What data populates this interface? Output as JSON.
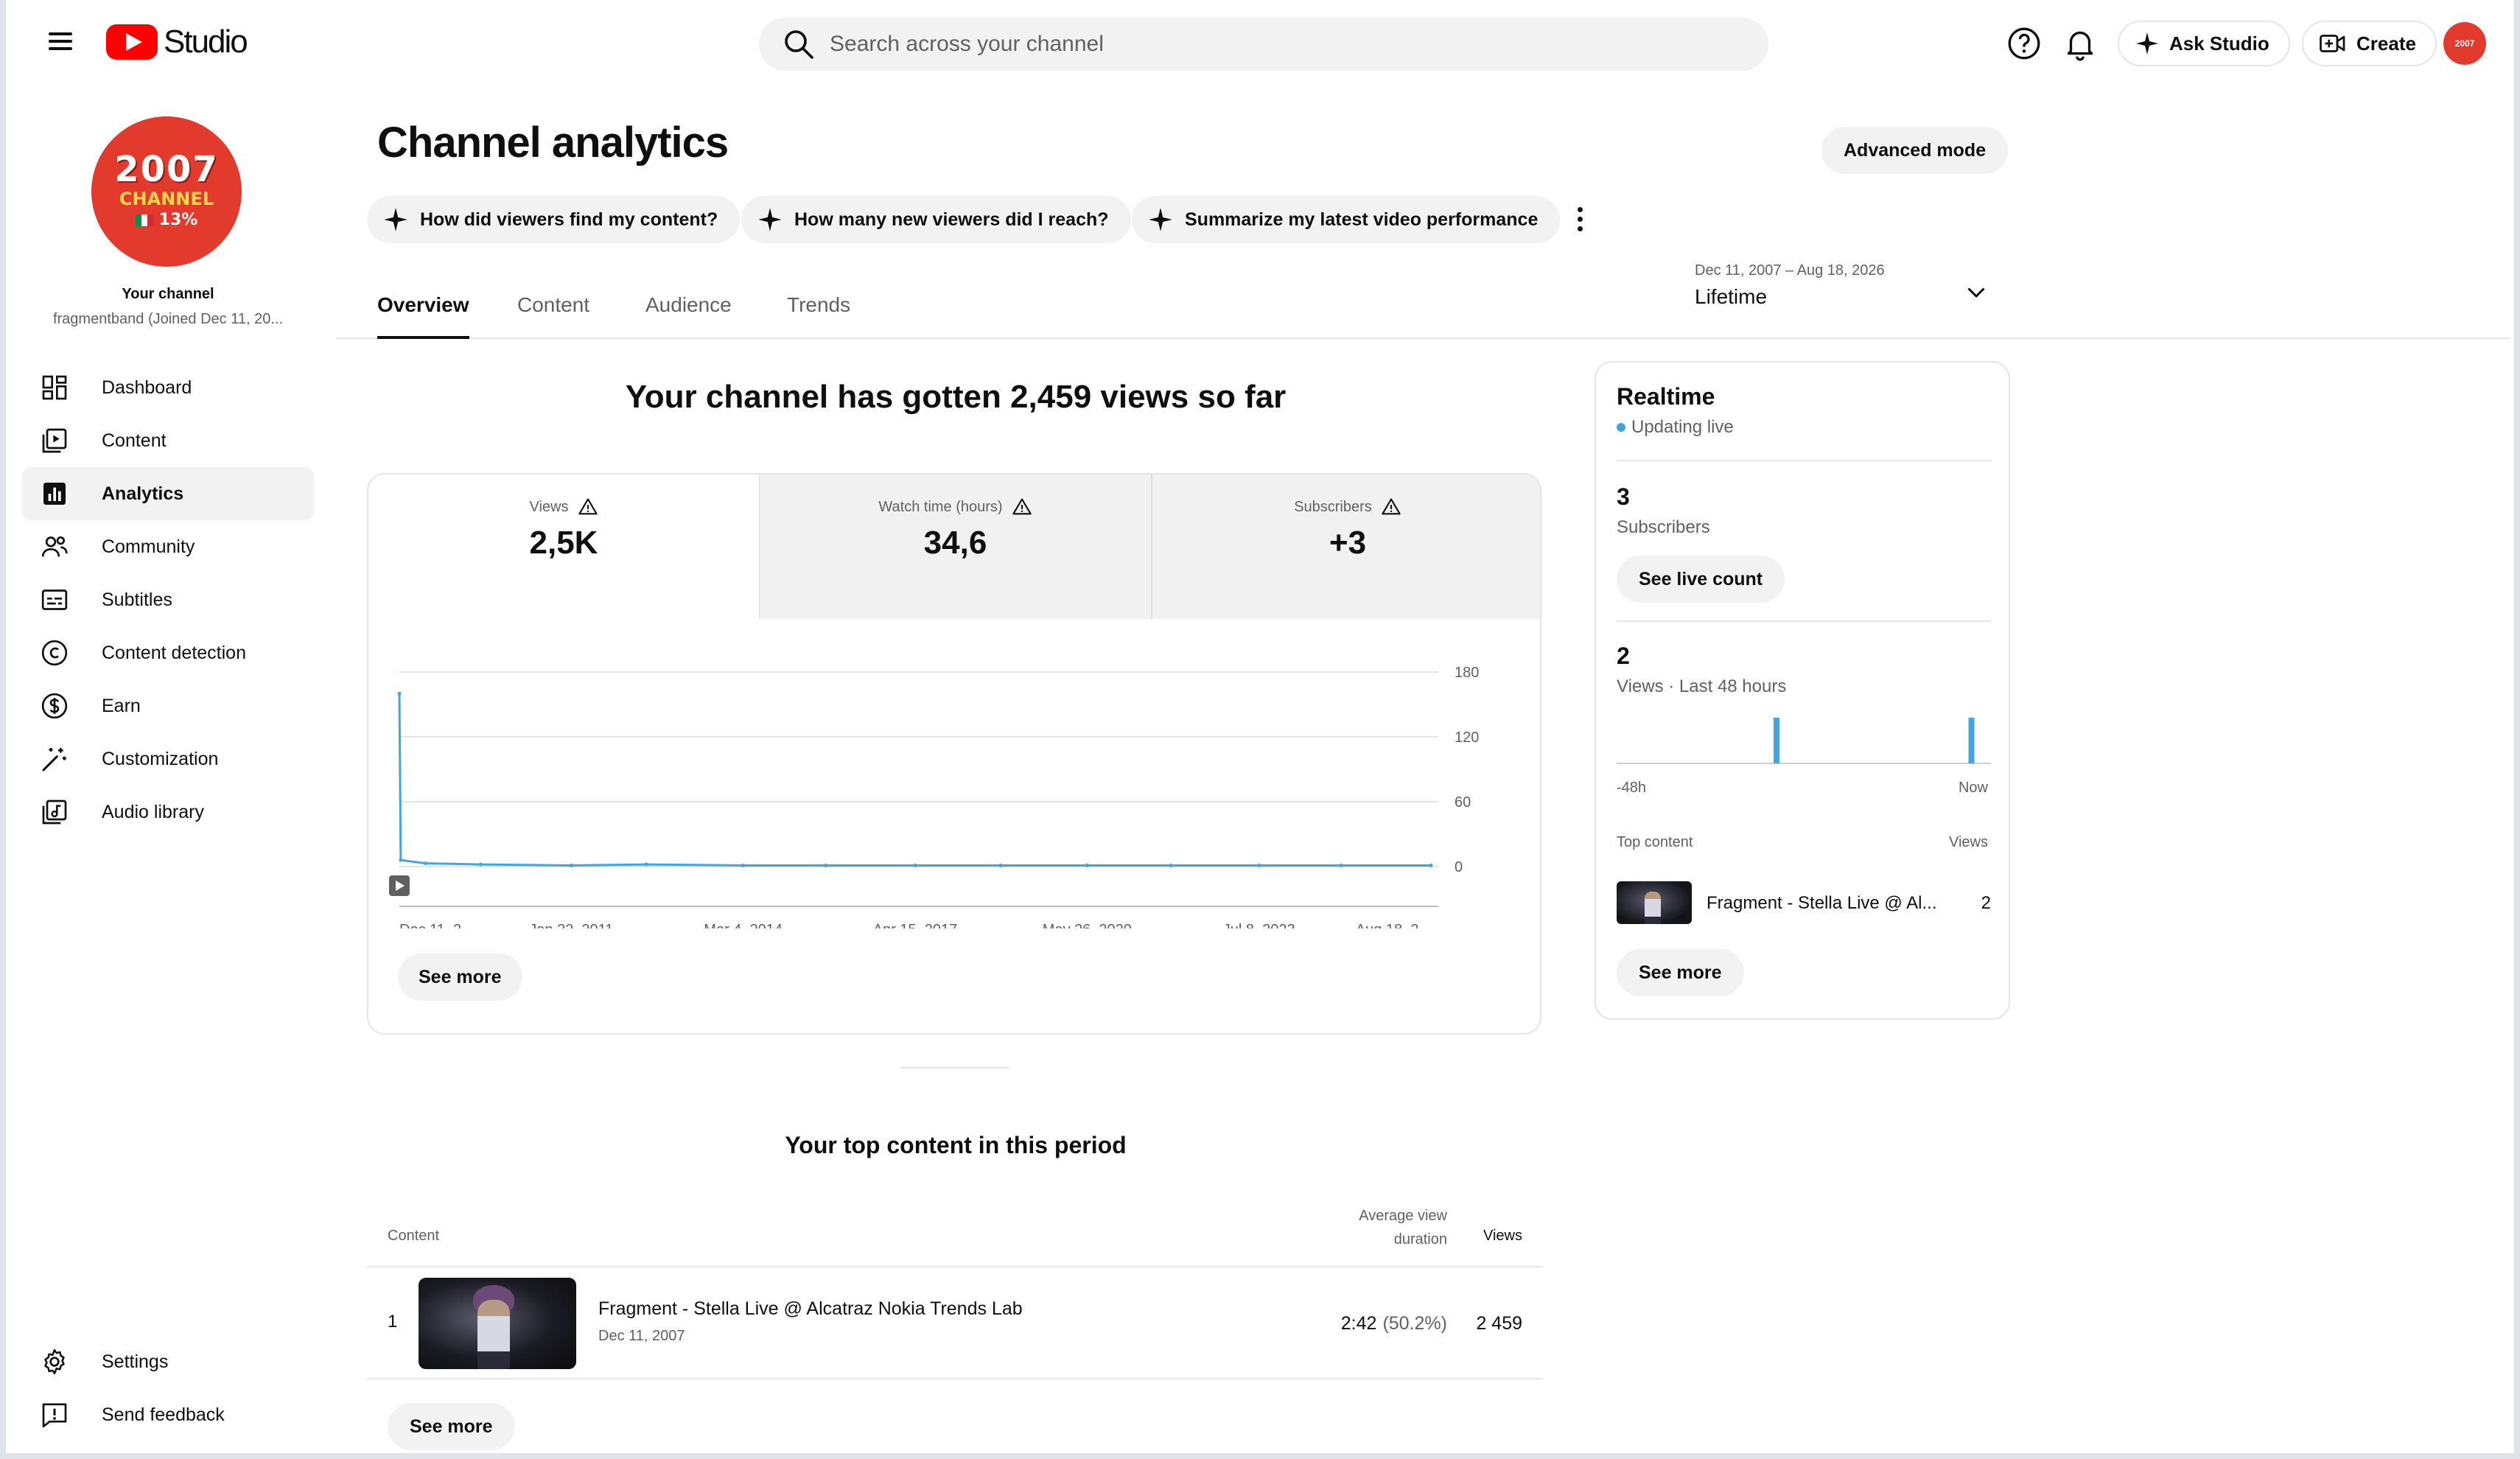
{
  "header": {
    "logo_text": "Studio",
    "search_placeholder": "Search across your channel",
    "ask_studio_label": "Ask Studio",
    "create_label": "Create",
    "avatar_text": "2007"
  },
  "sidebar": {
    "channel_avatar": {
      "year": "2007",
      "word": "CHANNEL",
      "pct": "13%"
    },
    "your_channel_label": "Your channel",
    "channel_handle": "fragmentband (Joined Dec 11, 20...",
    "items": [
      {
        "label": "Dashboard",
        "icon": "dashboard-icon"
      },
      {
        "label": "Content",
        "icon": "content-icon"
      },
      {
        "label": "Analytics",
        "icon": "analytics-icon",
        "active": true
      },
      {
        "label": "Community",
        "icon": "community-icon"
      },
      {
        "label": "Subtitles",
        "icon": "subtitles-icon"
      },
      {
        "label": "Content detection",
        "icon": "copyright-icon"
      },
      {
        "label": "Earn",
        "icon": "dollar-icon"
      },
      {
        "label": "Customization",
        "icon": "magic-wand-icon"
      },
      {
        "label": "Audio library",
        "icon": "audio-library-icon"
      }
    ],
    "bottom_items": [
      {
        "label": "Settings",
        "icon": "gear-icon"
      },
      {
        "label": "Send feedback",
        "icon": "feedback-icon"
      }
    ]
  },
  "main": {
    "title": "Channel analytics",
    "advanced_mode_label": "Advanced mode",
    "chips": [
      "How did viewers find my content?",
      "How many new viewers did I reach?",
      "Summarize my latest video performance"
    ],
    "tabs": [
      "Overview",
      "Content",
      "Audience",
      "Trends"
    ],
    "active_tab": "Overview",
    "date_range": {
      "range": "Dec 11, 2007 – Aug 18, 2026",
      "label": "Lifetime"
    },
    "headline": "Your channel has gotten 2,459 views so far",
    "metrics": [
      {
        "label": "Views",
        "value": "2,5K"
      },
      {
        "label": "Watch time (hours)",
        "value": "34,6"
      },
      {
        "label": "Subscribers",
        "value": "+3"
      }
    ],
    "see_more_label": "See more",
    "top_content": {
      "title": "Your top content in this period",
      "headers": {
        "content": "Content",
        "avd_line1": "Average view",
        "avd_line2": "duration",
        "views": "Views"
      },
      "rows": [
        {
          "rank": "1",
          "title": "Fragment - Stella Live @ Alcatraz Nokia Trends Lab",
          "date": "Dec 11, 2007",
          "avd": "2:42",
          "avd_pct": "(50.2%)",
          "views": "2 459"
        }
      ],
      "see_more_label": "See more"
    }
  },
  "realtime": {
    "title": "Realtime",
    "status": "Updating live",
    "subscribers_value": "3",
    "subscribers_label": "Subscribers",
    "see_live_count_label": "See live count",
    "views_value": "2",
    "views_label": "Views · Last 48 hours",
    "axis_start": "-48h",
    "axis_end": "Now",
    "hourly_views": [
      0,
      0,
      0,
      0,
      0,
      0,
      0,
      0,
      0,
      0,
      0,
      0,
      0,
      0,
      0,
      0,
      0,
      0,
      0,
      0,
      1,
      0,
      0,
      0,
      0,
      0,
      0,
      0,
      0,
      0,
      0,
      0,
      0,
      0,
      0,
      0,
      0,
      0,
      0,
      0,
      0,
      0,
      0,
      0,
      0,
      1,
      0,
      0
    ],
    "top_content_label": "Top content",
    "views_col_label": "Views",
    "top_item": {
      "title": "Fragment - Stella Live @ Al...",
      "views": "2"
    },
    "see_more_label": "See more"
  },
  "chart_data": {
    "type": "line",
    "title": "",
    "xlabel": "",
    "ylabel": "",
    "x_ticks": [
      "Dec 11, 2...",
      "Jan 22, 2011",
      "Mar 4, 2014",
      "Apr 15, 2017",
      "May 26, 2020",
      "Jul 8, 2023",
      "Aug 18, 2..."
    ],
    "y_ticks": [
      "180",
      "120",
      "60",
      "0"
    ],
    "ylim": [
      0,
      180
    ],
    "x": [
      "2007-12-11",
      "2007-12-20",
      "2008-06-01",
      "2009-06-01",
      "2011-01-22",
      "2012-06-01",
      "2014-03-04",
      "2015-09-01",
      "2017-04-15",
      "2018-11-01",
      "2020-05-26",
      "2021-12-01",
      "2023-07-08",
      "2025-01-01",
      "2026-08-18"
    ],
    "series": [
      {
        "values": [
          160,
          6,
          3,
          2,
          1,
          2,
          1,
          1,
          1,
          1,
          1,
          1,
          1,
          1,
          1
        ],
        "color": "#41a6e0"
      }
    ],
    "grid": true
  },
  "colors": {
    "accent": "#41a6e0",
    "brand": "#ff0000"
  }
}
